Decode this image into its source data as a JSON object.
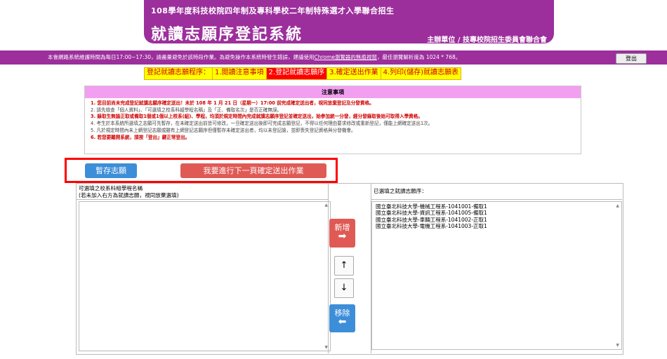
{
  "header": {
    "subtitle": "108學年度科技校院四年制及專科學校二年制特殊選才入學聯合招生",
    "title": "就讀志願序登記系統",
    "organizer": "主辦單位 / 技專校院招生委員會聯合會"
  },
  "notice": {
    "text_before": "本會網路系統維護時間為每日17:00~17:30，請盡量避免於該時段作業。為避免操作本系統時發生錯誤，建議使用",
    "chrome_link": "Chrome瀏覽器的無痕視窗",
    "text_after": "，最佳瀏覽解析度為 1024 * 768。",
    "logout_label": "登出"
  },
  "steps": {
    "label": "登記就讀志願程序：",
    "items": [
      "1.閱讀注意事項",
      "2.登記就讀志願序",
      "3.確定送出作業",
      "4.列印(儲存)就讀志願表"
    ]
  },
  "notes": {
    "header": "注意事項",
    "items": [
      {
        "text": "1. 您目前尚未完成登記就讀志願序確定送出！未於 108 年 1 月 21 日（星期一）17:00 前完成確定送出者，視同放棄登記及分發資格。",
        "style": "red"
      },
      {
        "text": "2. 請先檢查「個人資料」、「可選填之校系科組學程名稱」及「正、備取名次」是否正確無誤。",
        "style": "gray"
      },
      {
        "text": "3. 錄取生無論正取或備取1個或1個以上校系(組)、學程，均須於規定時間內完成就讀志願序登記並確定送出，始參加統一分發，經分發錄取後始可取得入學資格。",
        "style": "red"
      },
      {
        "text": "4. 考生於本系統所選填之志願可先暫存，在未確定送出前皆可修改，一旦確定送出後即可完成志願登記，不得以任何理由要求修改或重新登記，僅能上網確定送出1次。",
        "style": "gray"
      },
      {
        "text": "5. 凡於規定時間內未上網登記志願或雖有上網登記志願序但僅暫存未確定送出者，均以未登記論，並即喪失登記資格與分發機會。",
        "style": "gray"
      },
      {
        "text": "6. 若您要離開系統，請按「登出」鍵正常登出。",
        "style": "red"
      }
    ]
  },
  "actions": {
    "save_label": "暫存志願",
    "next_label": "我要進行下一頁確定送出作業"
  },
  "left_panel": {
    "header_line1": "可選填之校系科組學程名稱",
    "header_line2": "(若未加入右方為就讀志願，視同放棄選填)"
  },
  "middle": {
    "add_label": "新增",
    "up_label": "↑",
    "down_label": "↓",
    "remove_label": "移除"
  },
  "right_panel": {
    "header": "已選填之就讀志願序：",
    "items": [
      "國立臺北科技大學-機械工程系-1041001-備取1",
      "國立臺北科技大學-資訊工程系-1041005-備取1",
      "國立臺北科技大學-車輛工程系-1041002-正取1",
      "國立臺北科技大學-電機工程系-1041003-正取1"
    ]
  },
  "colors": {
    "brand_purple": "#9c2f9c",
    "notes_header_pink": "#f29ff2",
    "button_blue": "#3d8ed8",
    "button_red": "#e05a55",
    "highlight_red": "#ff0000",
    "step_yellow": "#ffff00"
  }
}
